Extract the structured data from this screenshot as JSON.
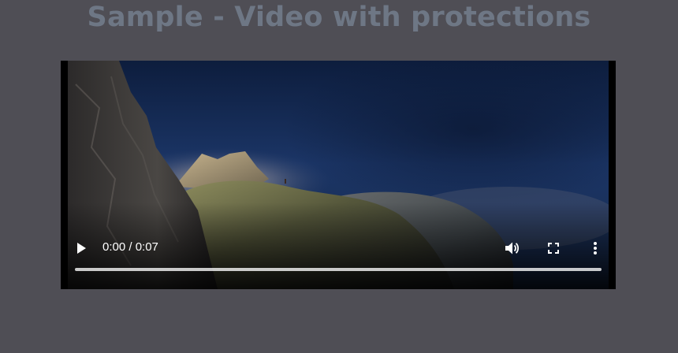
{
  "page": {
    "title": "Sample - Video with protections"
  },
  "video": {
    "current_time": "0:00",
    "duration": "0:07",
    "time_display": "0:00 / 0:07",
    "progress": 0,
    "controls": {
      "play_icon": "play-icon",
      "volume_icon": "volume-icon",
      "fullscreen_icon": "fullscreen-icon",
      "more_icon": "more-vertical-icon"
    }
  },
  "colors": {
    "background": "#4f4e55",
    "title": "#6e7785",
    "player": "#000000",
    "controls": "#ffffff"
  }
}
